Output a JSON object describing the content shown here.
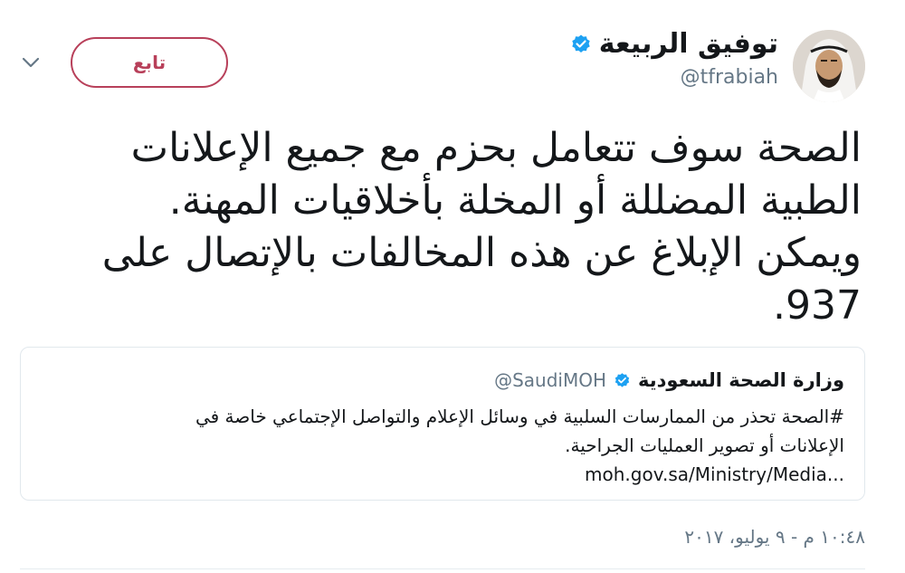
{
  "author": {
    "name": "توفيق الربيعة",
    "handle": "@tfrabiah"
  },
  "actions": {
    "follow_label": "تابع"
  },
  "tweet": {
    "lines": [
      "الصحة سوف تتعامل بحزم مع جميع الإعلانات",
      "الطبية المضللة أو المخلة بأخلاقيات المهنة.",
      "ويمكن الإبلاغ عن هذه المخالفات بالإتصال على",
      ".937"
    ]
  },
  "quote": {
    "name": "وزارة الصحة السعودية",
    "handle": "@SaudiMOH",
    "lines": [
      "#الصحة تحذر من الممارسات السلبية في وسائل الإعلام والتواصل الإجتماعي خاصة في",
      "الإعلانات أو تصوير العمليات الجراحية."
    ],
    "link": "moh.gov.sa/Ministry/Media..."
  },
  "timestamp": "١٠:٤٨ م - ٩ يوليو، ٢٠١٧",
  "colors": {
    "follow_accent": "#b8405a",
    "verified_blue": "#1da1f2",
    "secondary_text": "#657786"
  }
}
